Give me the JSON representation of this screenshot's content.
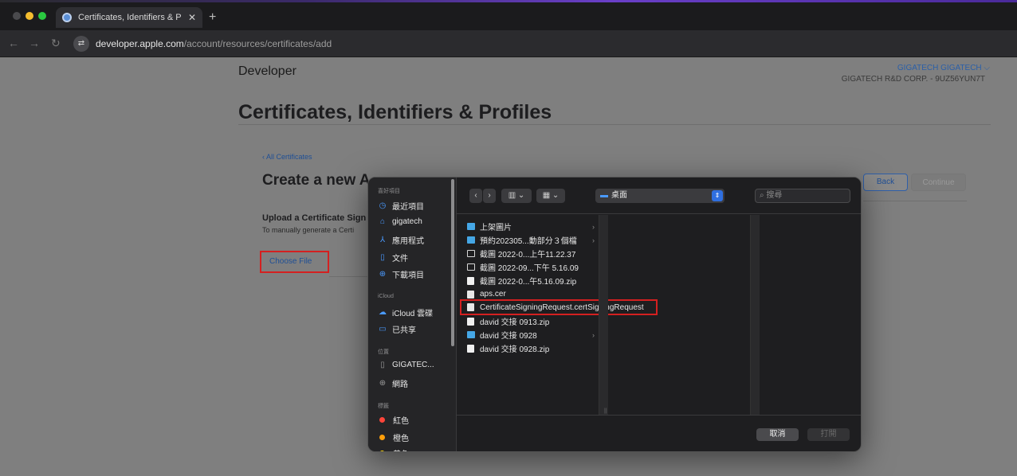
{
  "browser": {
    "tab_title": "Certificates, Identifiers & Profi",
    "url_host": "developer.apple.com",
    "url_path": "/account/resources/certificates/add"
  },
  "page": {
    "logo": "Developer",
    "account_name": "GIGATECH GIGATECH ⌵",
    "account_team": "GIGATECH R&D CORP. - 9UZ56YUN7T",
    "title": "Certificates, Identifiers & Profiles",
    "back_link": "‹ All Certificates",
    "create_title": "Create a new A",
    "back_button": "Back",
    "continue_button": "Continue",
    "upload_title": "Upload a Certificate Sign",
    "upload_desc": "To manually generate a Certi",
    "choose_file": "Choose File"
  },
  "dialog": {
    "sidebar": {
      "favorites_heading": "喜好項目",
      "favorites": [
        {
          "label": "最近項目",
          "icon": "clock-icon"
        },
        {
          "label": "gigatech",
          "icon": "home-icon"
        },
        {
          "label": "應用程式",
          "icon": "apps-icon"
        },
        {
          "label": "文件",
          "icon": "document-icon"
        },
        {
          "label": "下載項目",
          "icon": "download-icon"
        }
      ],
      "icloud_heading": "iCloud",
      "icloud": [
        {
          "label": "iCloud 雲碟",
          "icon": "cloud-icon"
        },
        {
          "label": "已共享",
          "icon": "shared-folder-icon"
        }
      ],
      "locations_heading": "位置",
      "locations": [
        {
          "label": "GIGATEC...",
          "icon": "disk-icon"
        },
        {
          "label": "網路",
          "icon": "globe-icon"
        }
      ],
      "tags_heading": "標籤",
      "tags": [
        {
          "label": "紅色",
          "color": "#ff453a"
        },
        {
          "label": "橙色",
          "color": "#ff9f0a"
        },
        {
          "label": "黃色",
          "color": "#ffd60a"
        }
      ]
    },
    "toolbar": {
      "location": "桌面",
      "search_placeholder": "搜尋"
    },
    "files": [
      {
        "name": "上架圖片",
        "type": "folder",
        "has_children": true
      },
      {
        "name": "預約202305...動部分３個檔",
        "type": "folder",
        "has_children": true
      },
      {
        "name": "截圖 2022-0...上午11.22.37",
        "type": "screenshot",
        "has_children": false
      },
      {
        "name": "截圖 2022-09...下午 5.16.09",
        "type": "screenshot",
        "has_children": false
      },
      {
        "name": "截圖 2022-0...午5.16.09.zip",
        "type": "zip",
        "has_children": false
      },
      {
        "name": "aps.cer",
        "type": "document",
        "has_children": false
      },
      {
        "name": "CertificateSigningRequest.certSigningRequest",
        "type": "document",
        "has_children": false,
        "selected": true
      },
      {
        "name": "david 交接 0913.zip",
        "type": "zip",
        "has_children": false
      },
      {
        "name": "david 交接 0928",
        "type": "folder",
        "has_children": true
      },
      {
        "name": "david 交接 0928.zip",
        "type": "zip",
        "has_children": false
      }
    ],
    "cancel_button": "取消",
    "open_button": "打開"
  }
}
